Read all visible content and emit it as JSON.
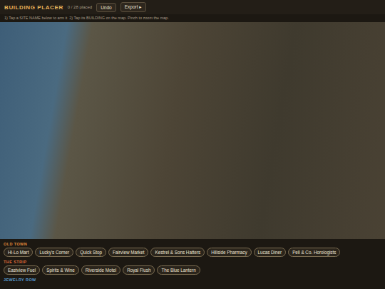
{
  "window": {
    "title": "BUILDING PLACER",
    "count": "0 / 28 placed"
  },
  "buttons": [
    "Undo",
    "Export ▸"
  ],
  "instructions": "1) Tap a SITE NAME below to arm it  2) Tap its BUILDING on the map. Pinch to zoom the map.",
  "sections": [
    {
      "label": "OLD TOWN",
      "color": "#e08a3c",
      "chips": [
        "Hi-Lo Mart",
        "Lucky's Corner",
        "Quick Stop",
        "Fairview Market",
        "Kestrel & Sons Hatters",
        "Hillside Pharmacy",
        "Lucas Diner",
        "Pell & Co. Horologists"
      ]
    },
    {
      "label": "THE STRIP",
      "color": "#e0703c",
      "chips": [
        "Eastview Fuel",
        "Spirits & Wine",
        "Riverside Motel",
        "Royal Flush",
        "The Blue Lantern"
      ]
    },
    {
      "label": "JEWELRY ROW",
      "color": "#5a9fd6",
      "chips": []
    }
  ]
}
